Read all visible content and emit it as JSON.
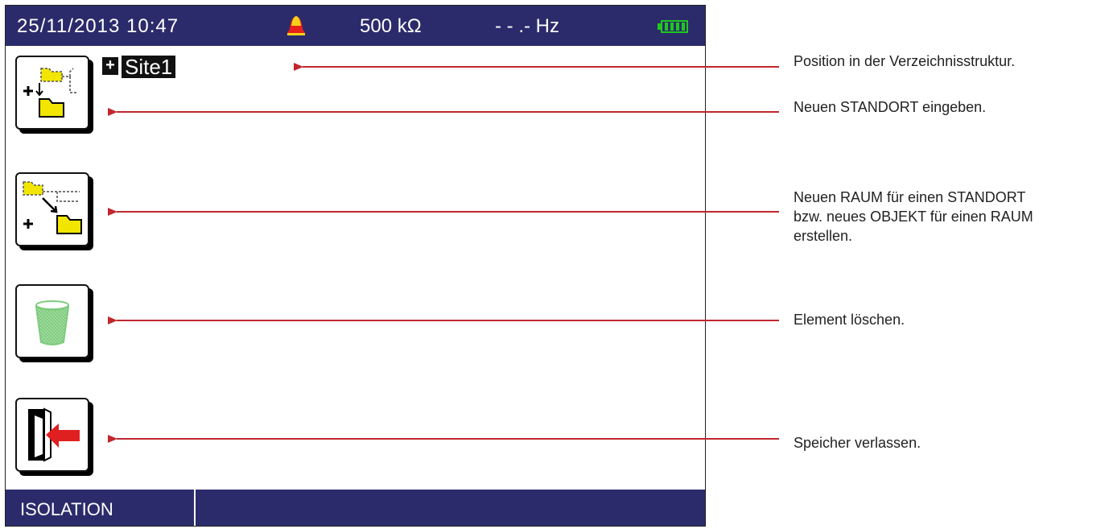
{
  "status_bar": {
    "datetime": "25/11/2013 10:47",
    "alarm_icon": "bell-icon",
    "resistance": "500  kΩ",
    "frequency": "- - .-  Hz",
    "battery_icon": "battery-full-icon"
  },
  "breadcrumb": {
    "expand_symbol": "+",
    "location": "Site1"
  },
  "buttons": [
    {
      "icon": "new-site-icon"
    },
    {
      "icon": "new-child-icon"
    },
    {
      "icon": "trash-icon"
    },
    {
      "icon": "exit-icon"
    }
  ],
  "mode_bar": {
    "mode": "ISOLATION"
  },
  "annotations": {
    "position": "Position in der Verzeichnisstruktur.",
    "new_site": "Neuen STANDORT eingeben.",
    "new_child": [
      "Neuen RAUM für einen STANDORT",
      "bzw. neues OBJEKT für einen RAUM",
      "erstellen."
    ],
    "delete": "Element löschen.",
    "exit": "Speicher verlassen."
  },
  "colors": {
    "bar_background": "#2b2b6b",
    "arrow": "#c0282e",
    "folder": "#f2e600",
    "trash": "#7ecb7e",
    "exit_arrow": "#e02020"
  }
}
